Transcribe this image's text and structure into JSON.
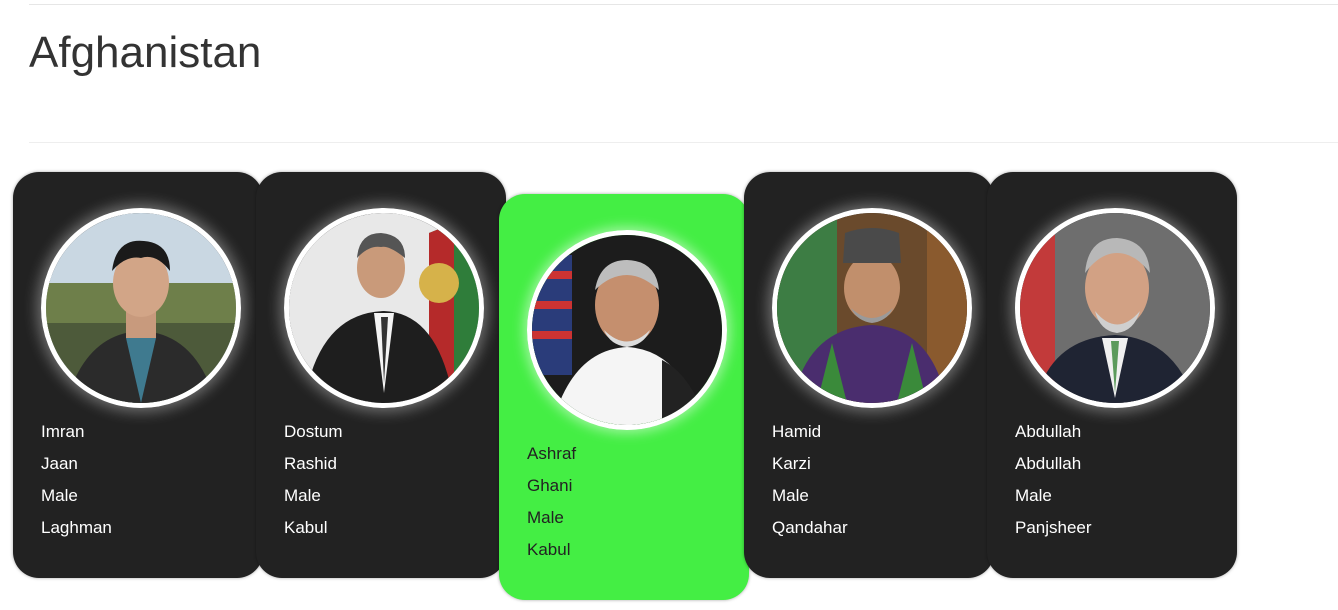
{
  "page": {
    "title": "Afghanistan"
  },
  "people": [
    {
      "first_name": "Imran",
      "last_name": "Jaan",
      "gender": "Male",
      "province": "Laghman",
      "active": false,
      "portrait": "young-man-portrait"
    },
    {
      "first_name": "Dostum",
      "last_name": "Rashid",
      "gender": "Male",
      "province": "Kabul",
      "active": false,
      "portrait": "man-in-suit-portrait"
    },
    {
      "first_name": "Ashraf",
      "last_name": "Ghani",
      "gender": "Male",
      "province": "Kabul",
      "active": true,
      "portrait": "man-white-shirt-portrait"
    },
    {
      "first_name": "Hamid",
      "last_name": "Karzi",
      "gender": "Male",
      "province": "Qandahar",
      "active": false,
      "portrait": "man-karakul-hat-portrait"
    },
    {
      "first_name": "Abdullah",
      "last_name": "Abdullah",
      "gender": "Male",
      "province": "Panjsheer",
      "active": false,
      "portrait": "man-grey-hair-portrait"
    }
  ],
  "colors": {
    "card_bg": "#222222",
    "active_card_bg": "#44ee44",
    "card_text": "#ffffff",
    "active_card_text": "#222222"
  }
}
